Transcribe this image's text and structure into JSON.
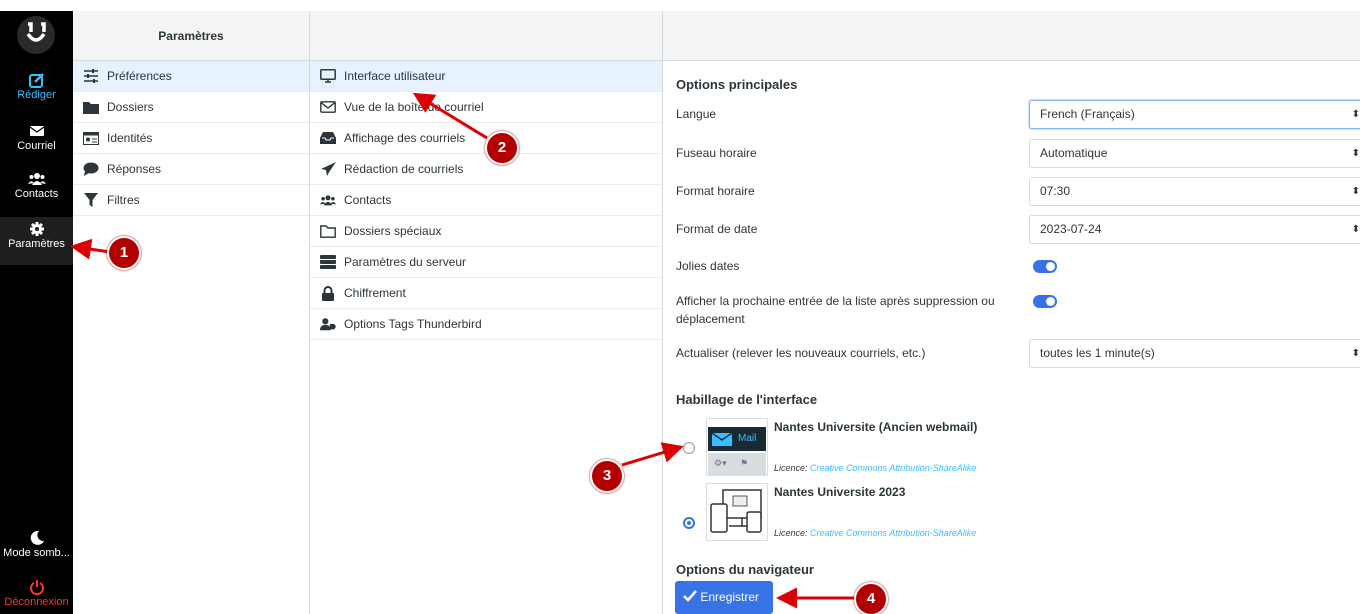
{
  "nav": {
    "compose": "Rédiger",
    "mail": "Courriel",
    "contacts": "Contacts",
    "settings": "Paramètres",
    "dark_mode": "Mode somb...",
    "logout": "Déconnexion"
  },
  "settings_col": {
    "title": "Paramètres",
    "items": [
      {
        "label": "Préférences",
        "icon": "sliders-icon"
      },
      {
        "label": "Dossiers",
        "icon": "folder-icon"
      },
      {
        "label": "Identités",
        "icon": "id-card-icon"
      },
      {
        "label": "Réponses",
        "icon": "comment-icon"
      },
      {
        "label": "Filtres",
        "icon": "filter-icon"
      }
    ]
  },
  "prefs_col": {
    "items": [
      {
        "label": "Interface utilisateur",
        "icon": "monitor-icon"
      },
      {
        "label": "Vue de la boîte de courriel",
        "icon": "envelope-icon"
      },
      {
        "label": "Affichage des courriels",
        "icon": "inbox-icon"
      },
      {
        "label": "Rédaction de courriels",
        "icon": "paper-plane-icon"
      },
      {
        "label": "Contacts",
        "icon": "users-icon"
      },
      {
        "label": "Dossiers spéciaux",
        "icon": "folder-outline-icon"
      },
      {
        "label": "Paramètres du serveur",
        "icon": "server-icon"
      },
      {
        "label": "Chiffrement",
        "icon": "lock-icon"
      },
      {
        "label": "Options Tags Thunderbird",
        "icon": "user-tag-icon"
      }
    ]
  },
  "main": {
    "section_main": "Options principales",
    "language_label": "Langue",
    "language_value": "French (Français)",
    "timezone_label": "Fuseau horaire",
    "timezone_value": "Automatique",
    "time_format_label": "Format horaire",
    "time_format_value": "07:30",
    "date_format_label": "Format de date",
    "date_format_value": "2023-07-24",
    "pretty_dates_label": "Jolies dates",
    "next_entry_label_1": "Afficher la prochaine entrée de la liste après suppression ou",
    "next_entry_label_2": "déplacement",
    "refresh_label": "Actualiser (relever les nouveaux courriels, etc.)",
    "refresh_value": "toutes les 1 minute(s)",
    "section_skin": "Habillage de l'interface",
    "skin1_name": "Nantes Universite (Ancien webmail)",
    "skin1_thumb_text": "Mail",
    "skin2_name": "Nantes Universite 2023",
    "license_prefix": "Licence: ",
    "license_link": "Creative Commons Attribution-ShareAlike",
    "section_browser": "Options du navigateur",
    "save_label": "Enregistrer"
  },
  "annotations": [
    "1",
    "2",
    "3",
    "4"
  ],
  "colors": {
    "accent": "#3773e6",
    "annotation": "#b20000",
    "compose": "#37beff",
    "logout": "#ff3333"
  }
}
